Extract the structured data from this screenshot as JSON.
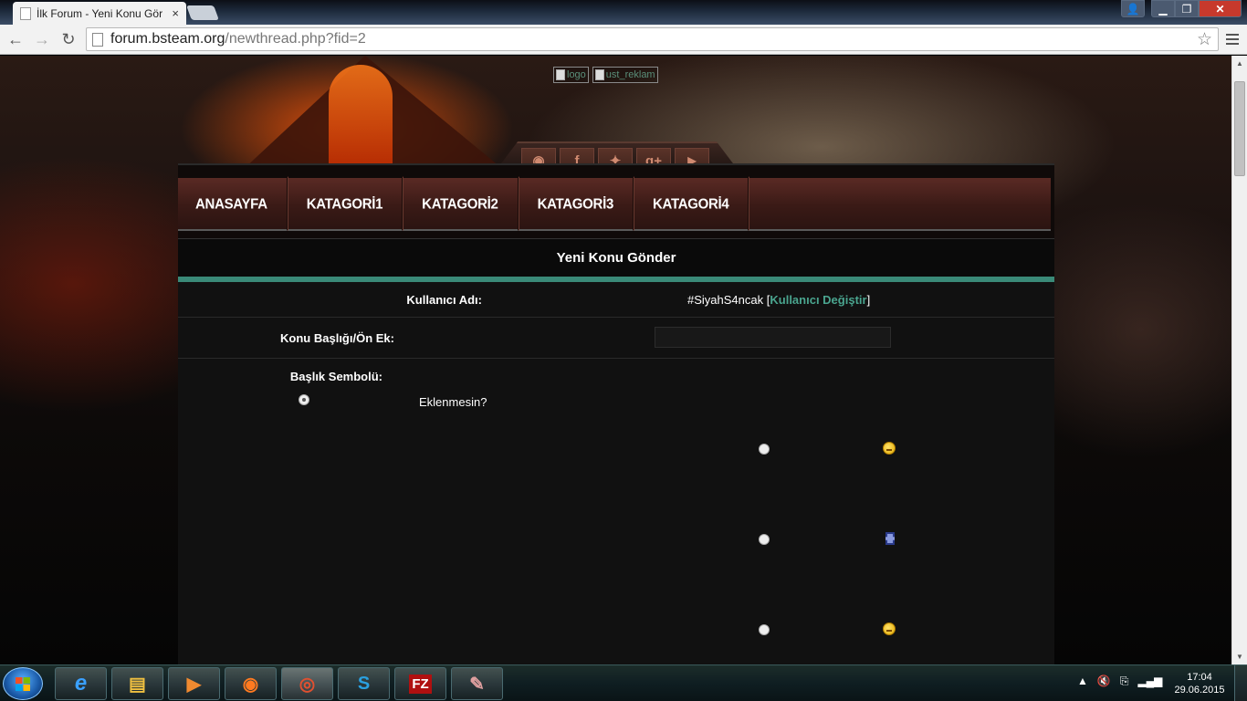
{
  "browser": {
    "tab_title": "İlk Forum - Yeni Konu Gör",
    "tab_close": "×",
    "url_host": "forum.bsteam.org",
    "url_path": "/newthread.php?fid=2",
    "back": "←",
    "forward": "→",
    "reload": "↻",
    "star": "☆",
    "window_close": "✕",
    "window_min": "▁",
    "window_max": "❐",
    "window_user": "👤"
  },
  "header": {
    "images": [
      {
        "alt": "logo"
      },
      {
        "alt": "ust_reklam"
      }
    ],
    "social": [
      {
        "icon": "rss-icon",
        "glyph": "◉"
      },
      {
        "icon": "facebook-icon",
        "glyph": "f"
      },
      {
        "icon": "twitter-icon",
        "glyph": "✦"
      },
      {
        "icon": "googleplus-icon",
        "glyph": "g+"
      },
      {
        "icon": "youtube-icon",
        "glyph": "▶"
      }
    ]
  },
  "nav": {
    "items": [
      "ANASAYFA",
      "KATAGORİ1",
      "KATAGORİ2",
      "KATAGORİ3",
      "KATAGORİ4"
    ]
  },
  "form": {
    "title": "Yeni Konu Gönder",
    "username_label": "Kullanıcı Adı:",
    "username_value": "#SiyahS4ncak",
    "change_user_open": "[",
    "change_user_link": "Kullanıcı Değiştir",
    "change_user_close": "]",
    "subject_label": "Konu Başlığı/Ön Ek:",
    "subject_value": "",
    "icon_label": "Başlık Sembolü:",
    "no_icon_label": "Eklenmesin?",
    "icon_options": [
      {
        "icon": "confused-smiley-icon",
        "selected": false
      },
      {
        "icon": "video-icon",
        "selected": false
      },
      {
        "icon": "sad-smiley-icon",
        "selected": false
      }
    ]
  },
  "taskbar": {
    "apps": [
      {
        "name": "internet-explorer",
        "glyph": "e",
        "color": "#3aa0ff"
      },
      {
        "name": "file-explorer",
        "glyph": "▤",
        "color": "#f0c040"
      },
      {
        "name": "media-player",
        "glyph": "▶",
        "color": "#f08a30"
      },
      {
        "name": "firefox",
        "glyph": "◉",
        "color": "#ff7a20"
      },
      {
        "name": "chrome",
        "glyph": "◎",
        "color": "#e0c030"
      },
      {
        "name": "skype",
        "glyph": "S",
        "color": "#2aa0e0"
      },
      {
        "name": "filezilla",
        "glyph": "FZ",
        "color": "#ffffff"
      },
      {
        "name": "paint",
        "glyph": "✎",
        "color": "#e0a0a0"
      }
    ],
    "time": "17:04",
    "date": "29.06.2015"
  }
}
